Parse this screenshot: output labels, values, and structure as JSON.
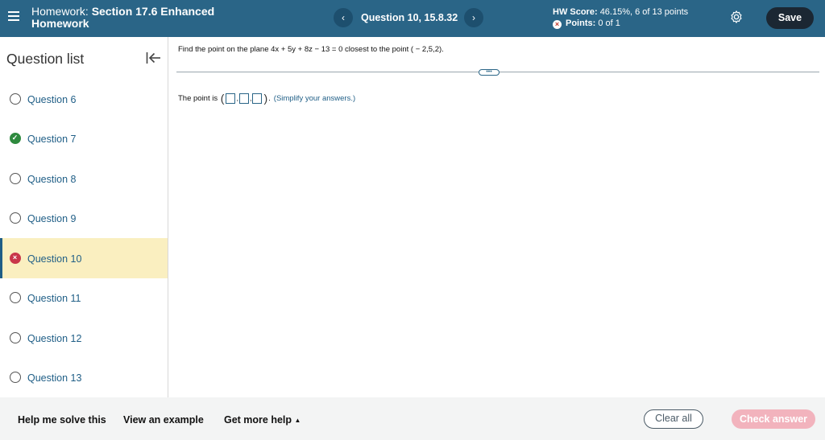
{
  "header": {
    "title_prefix": "Homework:",
    "title_bold_1": "Section 17.6 Enhanced",
    "title_bold_2": "Homework",
    "question_nav": "Question 10, 15.8.32",
    "prev_icon": "chevron-left-icon",
    "next_icon": "chevron-right-icon",
    "hw_score_label": "HW Score:",
    "hw_score_value": "46.15%, 6 of 13 points",
    "points_label": "Points:",
    "points_value": "0 of 1",
    "save_label": "Save"
  },
  "sidebar": {
    "title": "Question list",
    "items": [
      {
        "label": "Question 6",
        "status": "unanswered"
      },
      {
        "label": "Question 7",
        "status": "correct"
      },
      {
        "label": "Question 8",
        "status": "unanswered"
      },
      {
        "label": "Question 9",
        "status": "unanswered"
      },
      {
        "label": "Question 10",
        "status": "incorrect",
        "active": true
      },
      {
        "label": "Question 11",
        "status": "unanswered"
      },
      {
        "label": "Question 12",
        "status": "unanswered"
      },
      {
        "label": "Question 13",
        "status": "unanswered"
      }
    ]
  },
  "main": {
    "question_text": "Find the point on the plane 4x + 5y + 8z − 13 = 0 closest to the point ( − 2,5,2).",
    "answer_prefix": "The point is",
    "answer_suffix": ".",
    "answer_hint": "(Simplify your answers.)",
    "more_handle": "•••"
  },
  "footer": {
    "help_label": "Help me solve this",
    "example_label": "View an example",
    "more_help_label": "Get more help",
    "clear_label": "Clear all",
    "check_label": "Check answer"
  },
  "colors": {
    "header_bg": "#2a6587",
    "active_item_bg": "#faefc0",
    "correct": "#2e8a3e",
    "incorrect": "#c9374a",
    "check_disabled": "#f2b3bd"
  }
}
